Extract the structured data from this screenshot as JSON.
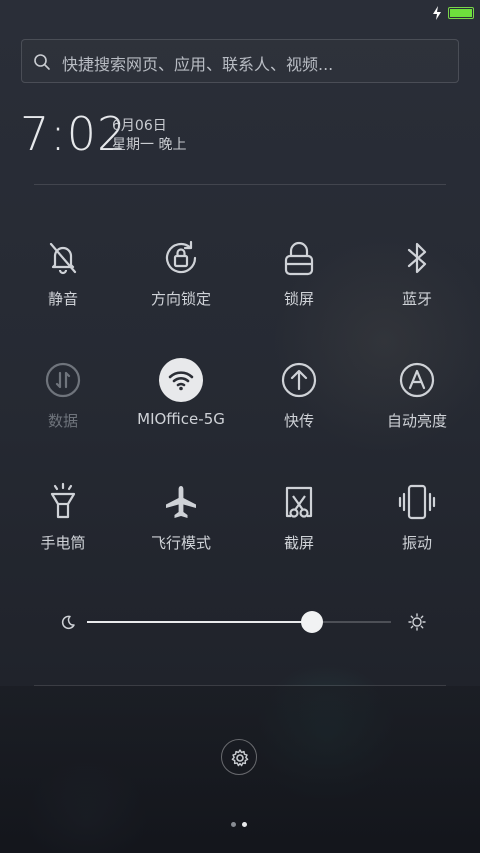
{
  "status_bar": {
    "battery_level": 1.0,
    "charging": true,
    "battery_color": "#6ee03c"
  },
  "search": {
    "placeholder": "快捷搜索网页、应用、联系人、视频..."
  },
  "clock": {
    "time": "7:02",
    "date": "6月06日",
    "weekday": "星期一 晚上"
  },
  "toggles": [
    {
      "label": "静音",
      "icon": "bell-off-icon",
      "active": false
    },
    {
      "label": "方向锁定",
      "icon": "rotation-lock-icon",
      "active": false
    },
    {
      "label": "锁屏",
      "icon": "lock-icon",
      "active": false
    },
    {
      "label": "蓝牙",
      "icon": "bluetooth-icon",
      "active": false
    },
    {
      "label": "数据",
      "icon": "mobile-data-icon",
      "active": false,
      "disabled": true
    },
    {
      "label": "MIOffice-5G",
      "icon": "wifi-icon",
      "active": true
    },
    {
      "label": "快传",
      "icon": "upload-icon",
      "active": false
    },
    {
      "label": "自动亮度",
      "icon": "auto-brightness-icon",
      "active": false
    },
    {
      "label": "手电筒",
      "icon": "flashlight-icon",
      "active": false
    },
    {
      "label": "飞行模式",
      "icon": "airplane-icon",
      "active": false
    },
    {
      "label": "截屏",
      "icon": "screenshot-icon",
      "active": false
    },
    {
      "label": "振动",
      "icon": "vibrate-icon",
      "active": false
    }
  ],
  "brightness": {
    "level": 0.74
  },
  "pager": {
    "pages": 2,
    "current": 2
  },
  "colors": {
    "accent": "#e8e9eb",
    "text": "#cfd2d7",
    "disabled_text": "#6f747c"
  }
}
